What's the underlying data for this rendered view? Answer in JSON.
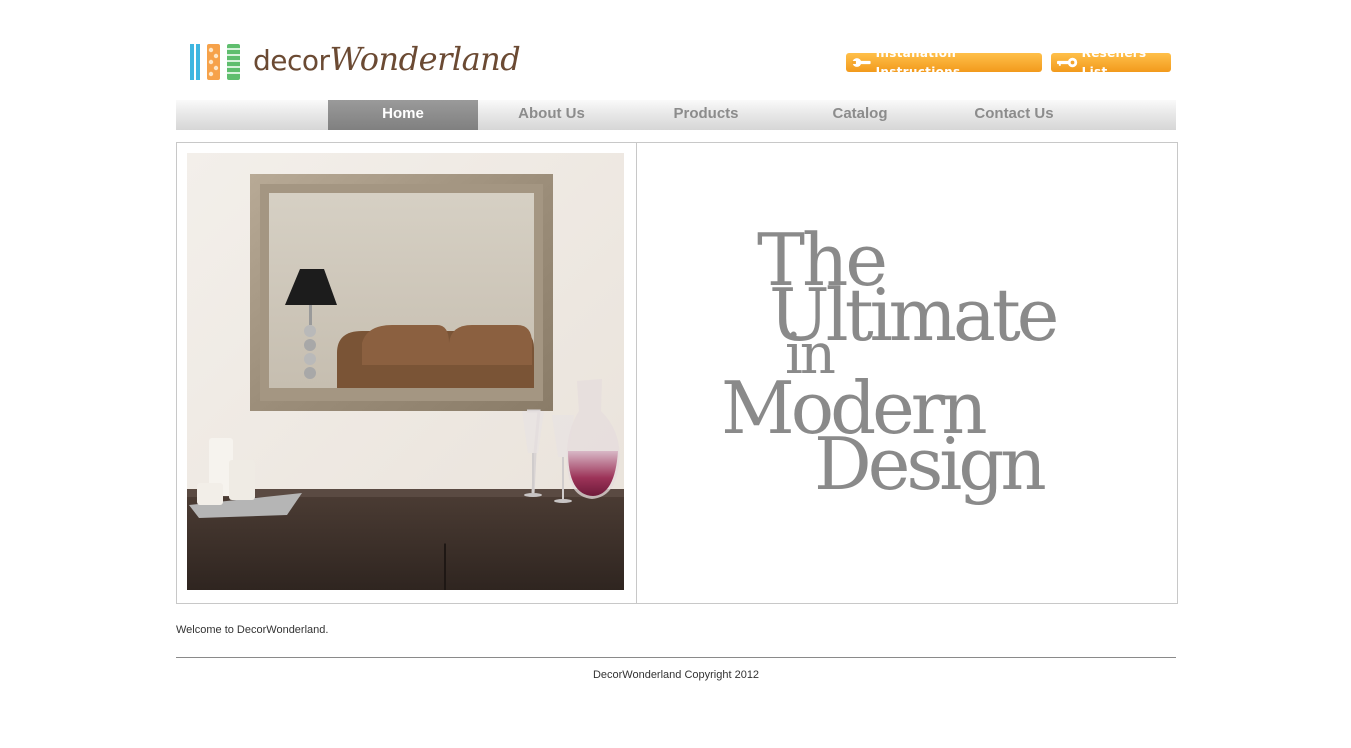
{
  "logo": {
    "text_plain": "decor",
    "text_script": "Wonderland"
  },
  "header_buttons": {
    "installation": "Installation Instructions",
    "resellers": "Resellers List"
  },
  "nav": {
    "items": [
      {
        "label": "Home",
        "active": true
      },
      {
        "label": "About Us"
      },
      {
        "label": "Products"
      },
      {
        "label": "Catalog"
      },
      {
        "label": "Contact Us"
      }
    ]
  },
  "hero": {
    "tagline_lines": [
      "The",
      "Ultimate",
      "in",
      "Modern",
      "Design"
    ]
  },
  "welcome_text": "Welcome to DecorWonderland.",
  "footer": {
    "copyright": "DecorWonderland Copyright 2012"
  },
  "colors": {
    "accent": "#f5a623",
    "nav_active": "#8c8c8c",
    "brand_brown": "#6b4a33"
  }
}
